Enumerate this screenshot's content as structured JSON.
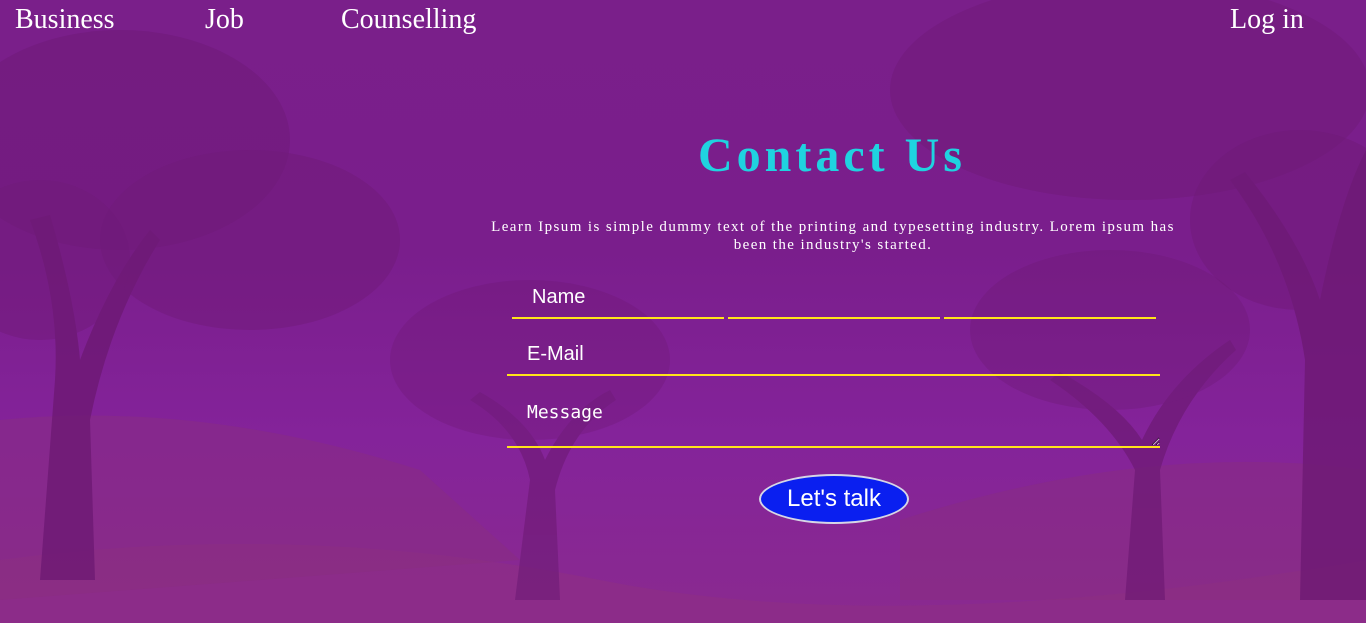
{
  "nav": {
    "business": "Business",
    "job": "Job",
    "counselling": "Counselling",
    "login": "Log in"
  },
  "contact": {
    "title": "Contact Us",
    "description": "Learn Ipsum is simple dummy text of the printing and typesetting industry. Lorem ipsum has been the industry's started."
  },
  "form": {
    "name_placeholder": "Name",
    "email_placeholder": "E-Mail",
    "message_placeholder": "Message",
    "submit_label": "Let's talk"
  },
  "colors": {
    "background": "#7a1f8a",
    "title": "#1fd3e0",
    "underline": "#ffe41a",
    "button": "#0a1ff0"
  }
}
